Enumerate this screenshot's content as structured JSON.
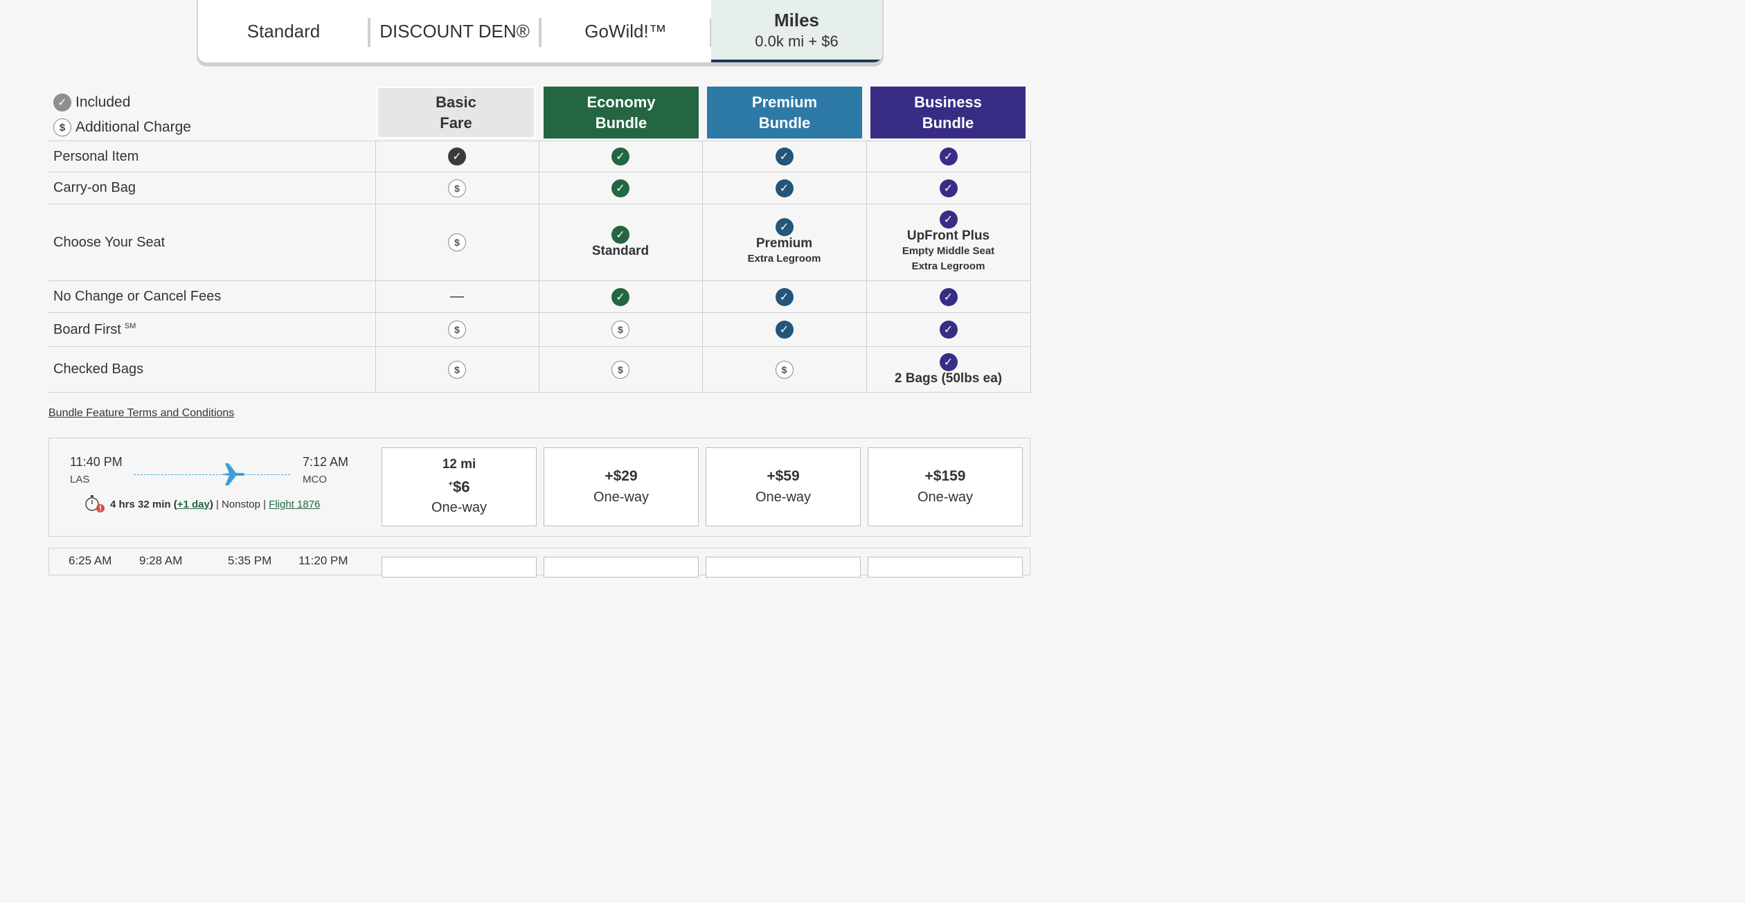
{
  "tabs": [
    {
      "label": "Standard"
    },
    {
      "label": "DISCOUNT DEN®"
    },
    {
      "label": "GoWild!™"
    },
    {
      "label": "Miles",
      "sub": "0.0k mi + $6",
      "active": true
    }
  ],
  "legend": {
    "included": "Included",
    "additional": "Additional Charge",
    "dollar": "$"
  },
  "bundles": [
    {
      "title1": "Basic",
      "title2": "Fare",
      "color": "#e6e6e6",
      "text": "#333333"
    },
    {
      "title1": "Economy",
      "title2": "Bundle",
      "color": "#246642",
      "text": "#ffffff"
    },
    {
      "title1": "Premium",
      "title2": "Bundle",
      "color": "#2d7aa6",
      "text": "#ffffff"
    },
    {
      "title1": "Business",
      "title2": "Bundle",
      "color": "#382d84",
      "text": "#ffffff"
    }
  ],
  "features": {
    "personal_item": "Personal Item",
    "carry_on": "Carry-on Bag",
    "seat": "Choose Your Seat",
    "no_fees": "No Change or Cancel Fees",
    "board_first": "Board First",
    "board_first_sup": "SM",
    "checked_bags": "Checked Bags",
    "dash": "—",
    "seat_eco": "Standard",
    "seat_prem": "Premium",
    "seat_prem_sub": "Extra Legroom",
    "seat_bus": "UpFront Plus",
    "seat_bus_sub1": "Empty Middle Seat",
    "seat_bus_sub2": "Extra Legroom",
    "bags_bus": "2 Bags (50lbs ea)"
  },
  "terms_link": "Bundle Feature Terms and Conditions",
  "flight": {
    "depart_time": "11:40 PM",
    "depart_airport": "LAS",
    "arrive_time": "7:12 AM",
    "arrive_airport": "MCO",
    "duration": "4 hrs 32 min (",
    "plus_day": "+1 day",
    "duration_close": ")",
    "nonstop": " | Nonstop | ",
    "flight_number": "Flight 1876",
    "prices": {
      "basic_miles": "12 mi",
      "basic_sup": "+",
      "basic_cash": "$6",
      "economy": "+$29",
      "premium": "+$59",
      "business": "+$159",
      "one_way": "One-way"
    }
  },
  "flight2": {
    "depart_time": "6:25 AM",
    "mid_time1": "9:28 AM",
    "mid_time2": "5:35 PM",
    "arrive_time": "11:20 PM"
  }
}
